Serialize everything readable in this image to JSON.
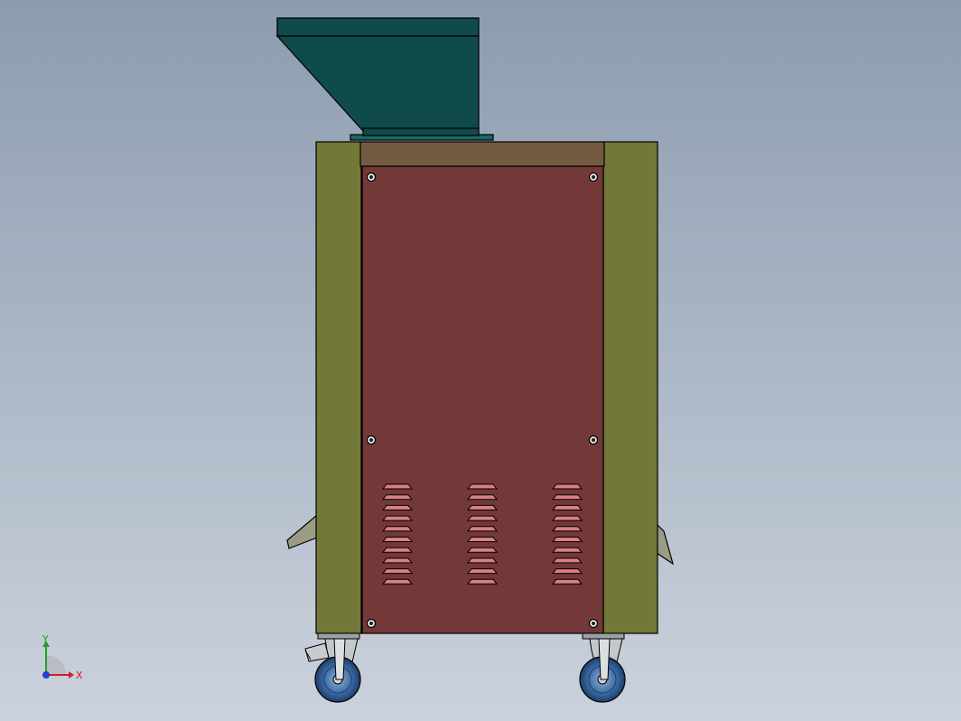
{
  "scene": {
    "background_top": "#8c9cb0",
    "background_bottom": "#cbd2dc"
  },
  "colors": {
    "hopper": "#0f4b4a",
    "hopper_base": "#1b6766",
    "top_band": "#735a40",
    "front_panel": "#733838",
    "side_posts": "#737838",
    "vent_slat": "#d98080",
    "wheel": "#3f6ea8",
    "caster_metal": "#c4c8cc",
    "outline": "#000000"
  },
  "machine": {
    "vent_columns": 3,
    "vent_slats_per_column": 10,
    "screws": 6,
    "casters": 2,
    "icons": [
      "screw-icon",
      "caster-wheel-icon",
      "brake-pedal-icon"
    ]
  },
  "triad": {
    "x_label": "X",
    "y_label": "Y",
    "x_color": "#d02020",
    "y_color": "#20a020",
    "z_color": "#2040d0"
  }
}
